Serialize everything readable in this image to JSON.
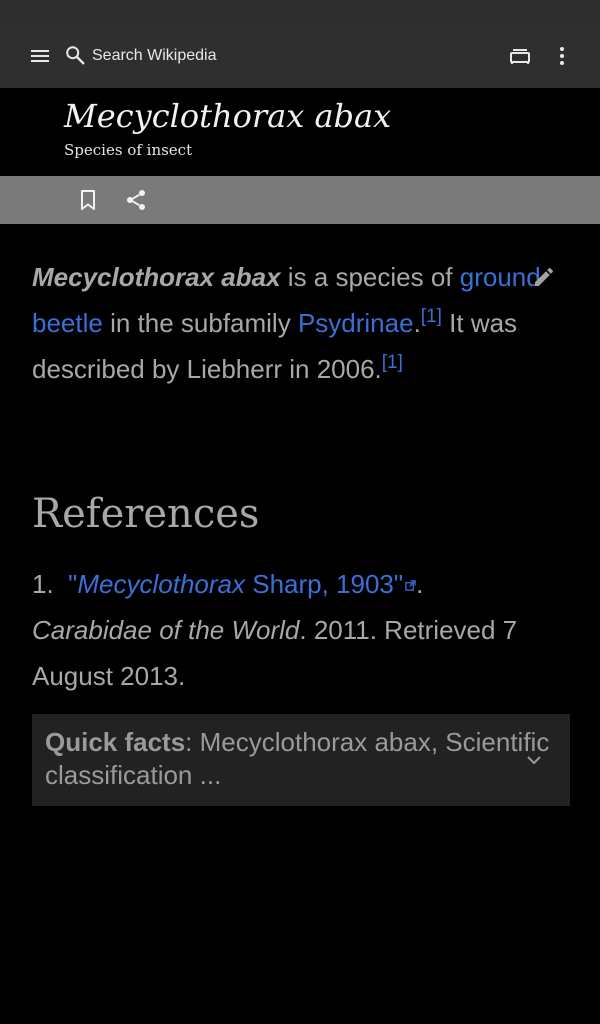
{
  "toolbar": {
    "search_placeholder": "Search Wikipedia",
    "icons": [
      "menu-icon",
      "search-icon",
      "tabs-icon",
      "more-vert-icon"
    ]
  },
  "article": {
    "title": "Mecyclothorax abax",
    "subtitle": "Species of insect",
    "lead": {
      "bold_name": "Mecyclothorax abax",
      "text1": " is a species of ",
      "link1": "ground beetle",
      "text2": " in the subfamily ",
      "link2": "Psydrinae",
      "text3": ".",
      "cite1": "[1]",
      "text4": " It was described by Liebherr in 2006.",
      "cite2": "[1]"
    }
  },
  "references": {
    "heading": "References",
    "items": [
      {
        "number": "1.",
        "link_prefix": "\"",
        "link_italic": "Mecyclothorax",
        "link_rest": " Sharp, 1903\"",
        "after_link": ".",
        "work": "Carabidae of the World",
        "tail": ". 2011. Retrieved 7 August 2013."
      }
    ]
  },
  "quick_facts": {
    "label": "Quick facts",
    "text": ": Mecyclothorax abax, Scientific classification ..."
  },
  "colors": {
    "link": "#3a6fd8",
    "toolbar_bg": "#2f2f2f",
    "action_bar_bg": "#7a7a7a",
    "body_text": "#a8a8a8"
  }
}
